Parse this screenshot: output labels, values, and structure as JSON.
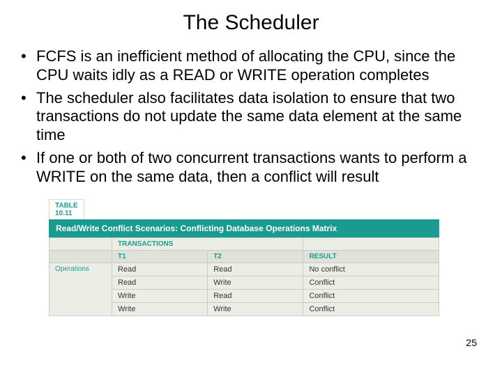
{
  "title": "The Scheduler",
  "bullets": [
    "FCFS is an inefficient method of allocating the CPU, since the CPU waits idly as a READ or WRITE operation completes",
    "The scheduler also facilitates data isolation to ensure that two transactions do not update the same data element at the same time",
    "If one or both of two concurrent transactions wants to perform a WRITE on the same data, then a conflict will result"
  ],
  "table": {
    "label_top": "TABLE",
    "label_num": "10.11",
    "caption": "Read/Write Conflict Scenarios: Conflicting Database Operations Matrix",
    "group_header": "TRANSACTIONS",
    "columns": {
      "rowhdr": "",
      "t1": "T1",
      "t2": "T2",
      "result": "RESULT"
    },
    "row_header": "Operations",
    "rows": [
      {
        "t1": "Read",
        "t2": "Read",
        "result": "No conflict"
      },
      {
        "t1": "Read",
        "t2": "Write",
        "result": "Conflict"
      },
      {
        "t1": "Write",
        "t2": "Read",
        "result": "Conflict"
      },
      {
        "t1": "Write",
        "t2": "Write",
        "result": "Conflict"
      }
    ]
  },
  "page_number": "25"
}
